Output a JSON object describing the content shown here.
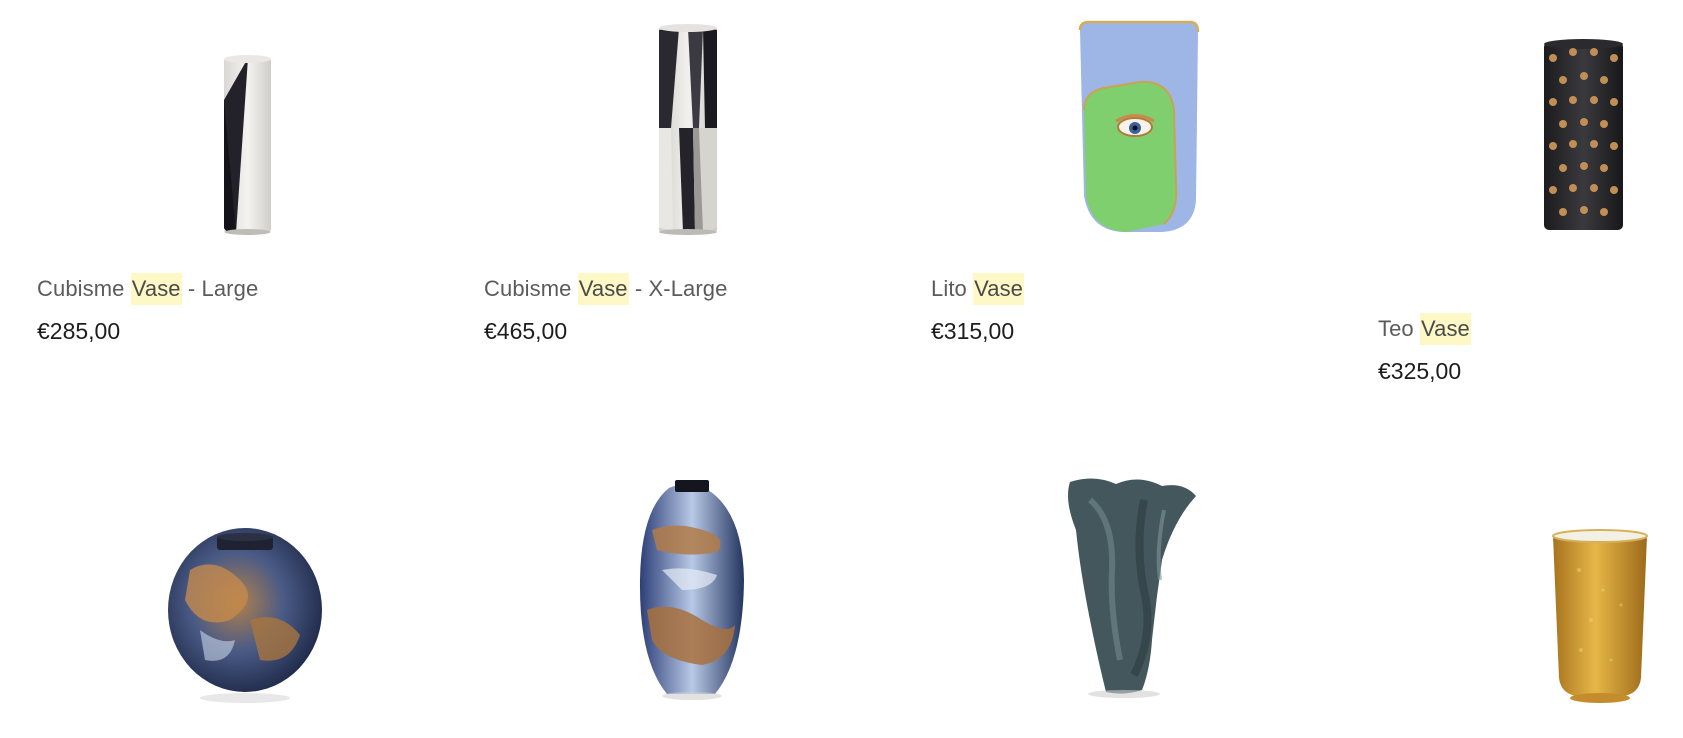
{
  "products": [
    {
      "name_before": "Cubisme ",
      "name_highlight": "Vase",
      "name_after": " - Large",
      "price": "€285,00"
    },
    {
      "name_before": "Cubisme ",
      "name_highlight": "Vase",
      "name_after": " - X-Large",
      "price": "€465,00"
    },
    {
      "name_before": "Lito ",
      "name_highlight": "Vase",
      "name_after": "",
      "price": "€315,00"
    },
    {
      "name_before": "Teo ",
      "name_highlight": "Vase",
      "name_after": "",
      "price": "€325,00"
    }
  ],
  "search_highlight_color": "#fdf8c6"
}
